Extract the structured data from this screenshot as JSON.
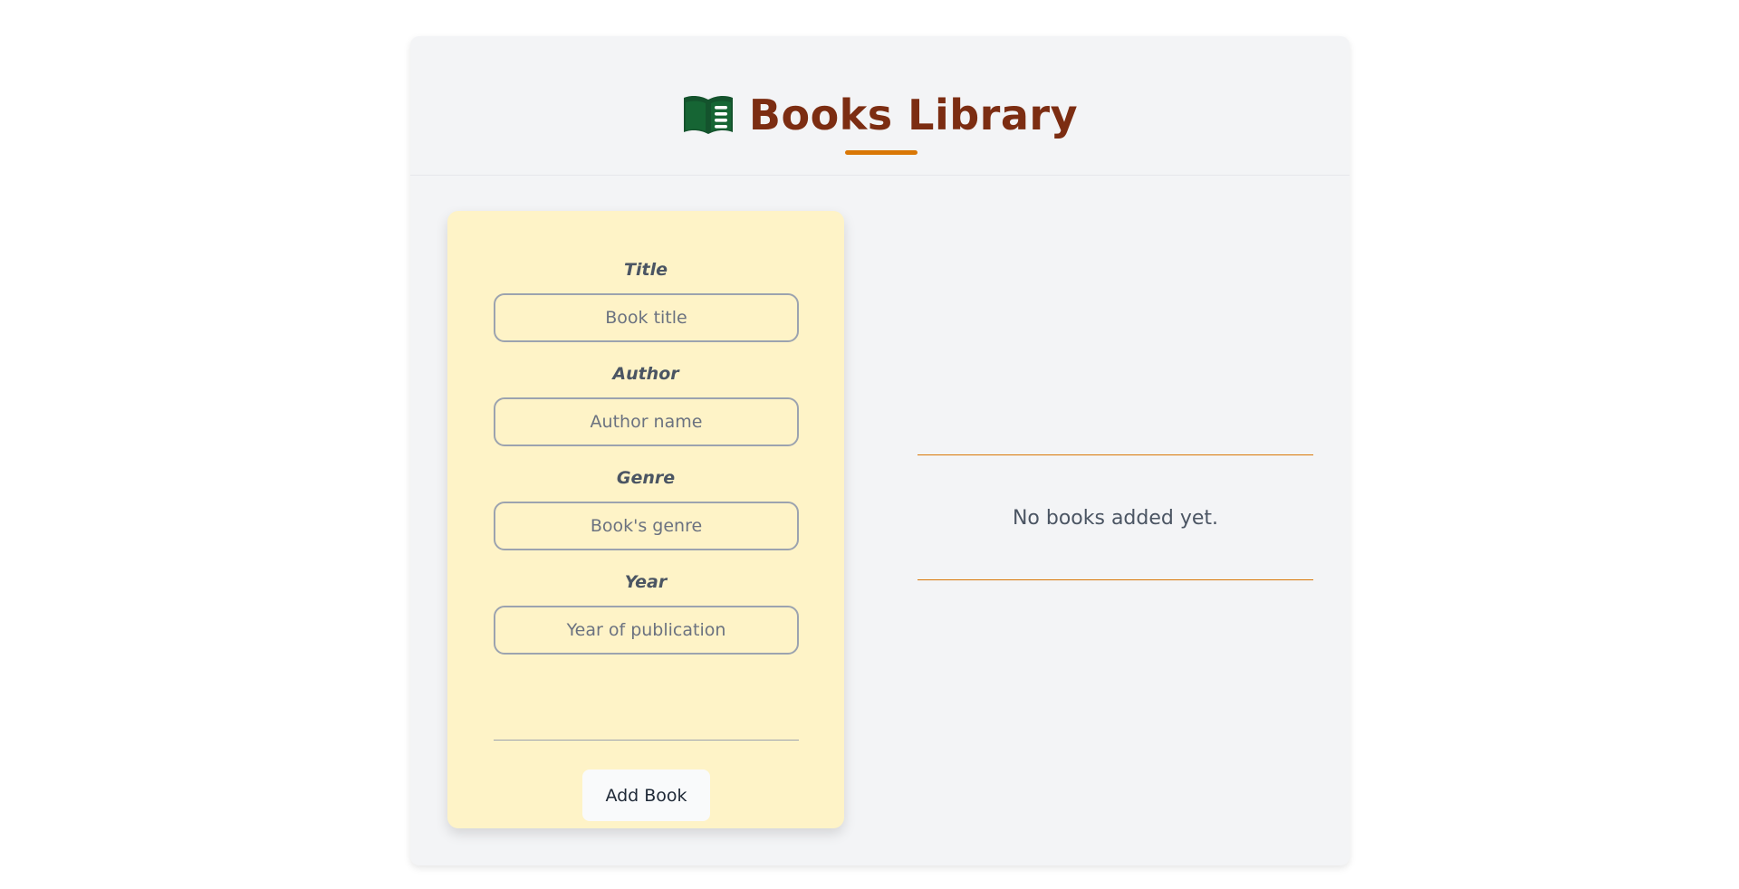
{
  "header": {
    "title": "Books Library",
    "icon": "open-book-icon",
    "icon_color": "#14532d",
    "title_color": "#7c2d12",
    "accent_color": "#d97706"
  },
  "form": {
    "fields": [
      {
        "label": "Title",
        "placeholder": "Book title",
        "value": ""
      },
      {
        "label": "Author",
        "placeholder": "Author name",
        "value": ""
      },
      {
        "label": "Genre",
        "placeholder": "Book's genre",
        "value": ""
      },
      {
        "label": "Year",
        "placeholder": "Year of publication",
        "value": ""
      }
    ],
    "submit_label": "Add Book",
    "background_color": "#fef3c7"
  },
  "list": {
    "empty_message": "No books added yet."
  }
}
